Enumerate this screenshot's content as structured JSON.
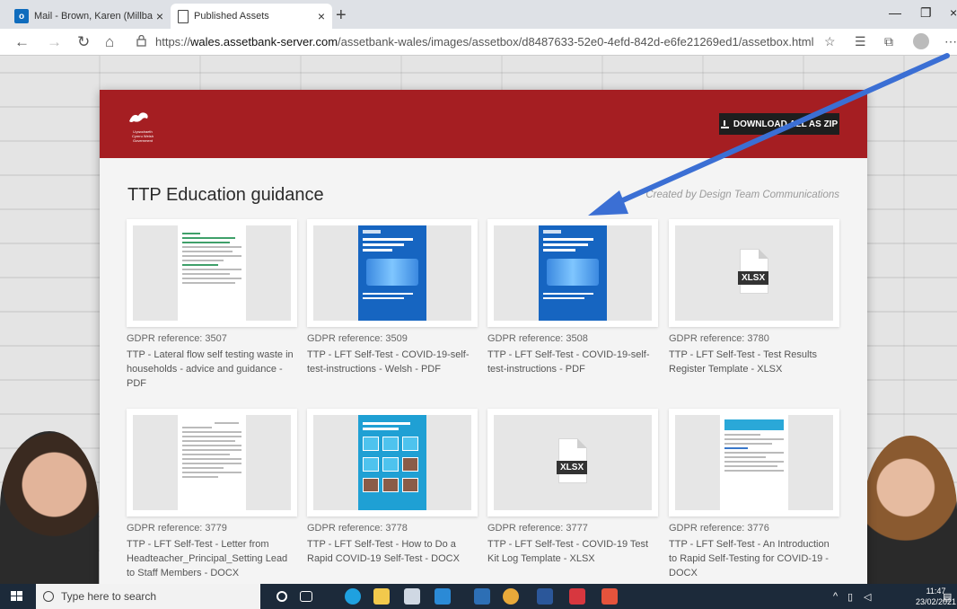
{
  "browser": {
    "tabs": [
      {
        "title": "Mail - Brown, Karen (Millbank P",
        "active": false,
        "icon": "outlook-icon"
      },
      {
        "title": "Published Assets",
        "active": true,
        "icon": "page-icon"
      }
    ],
    "url_scheme": "https://",
    "url_host": "wales.assetbank-server.com",
    "url_path": "/assetbank-wales/images/assetbox/d8487633-52e0-4efd-842d-e6fe21269ed1/assetbox.html"
  },
  "header": {
    "logo_text": "Llywodraeth Cymru Welsh Government",
    "download_label": "DOWNLOAD ALL AS ZIP"
  },
  "main": {
    "title": "TTP Education guidance",
    "byline": "Created by Design Team Communications"
  },
  "assets": [
    {
      "gdpr": "GDPR reference: 3507",
      "desc": "TTP - Lateral flow self testing waste in households - advice and guidance - PDF",
      "thumb": "document"
    },
    {
      "gdpr": "GDPR reference: 3509",
      "desc": "TTP - LFT Self-Test - COVID-19-self-test-instructions - Welsh - PDF",
      "thumb": "poster"
    },
    {
      "gdpr": "GDPR reference: 3508",
      "desc": "TTP - LFT Self-Test - COVID-19-self-test-instructions - PDF",
      "thumb": "poster"
    },
    {
      "gdpr": "GDPR reference: 3780",
      "desc": "TTP - LFT Self-Test - Test Results Register Template - XLSX",
      "thumb": "file",
      "file_tag": "XLSX"
    },
    {
      "gdpr": "GDPR reference: 3779",
      "desc": "TTP - LFT Self-Test - Letter from Headteacher_Principal_Setting Lead to Staff Members - DOCX",
      "thumb": "document"
    },
    {
      "gdpr": "GDPR reference: 3778",
      "desc": "TTP - LFT Self-Test - How to Do a Rapid COVID-19 Self-Test - DOCX",
      "thumb": "tiles"
    },
    {
      "gdpr": "GDPR reference: 3777",
      "desc": "TTP - LFT Self-Test - COVID-19 Test Kit Log Template - XLSX",
      "thumb": "file",
      "file_tag": "XLSX"
    },
    {
      "gdpr": "GDPR reference: 3776",
      "desc": "TTP - LFT Self-Test - An Introduction to Rapid Self-Testing for COVID-19 - DOCX",
      "thumb": "document"
    }
  ],
  "taskbar": {
    "search_placeholder": "Type here to search",
    "time": "11:47",
    "date": "23/02/2021"
  },
  "colors": {
    "header_red": "#a51e22",
    "annotation_arrow": "#3b6fd4",
    "poster_blue": "#1665c1"
  }
}
